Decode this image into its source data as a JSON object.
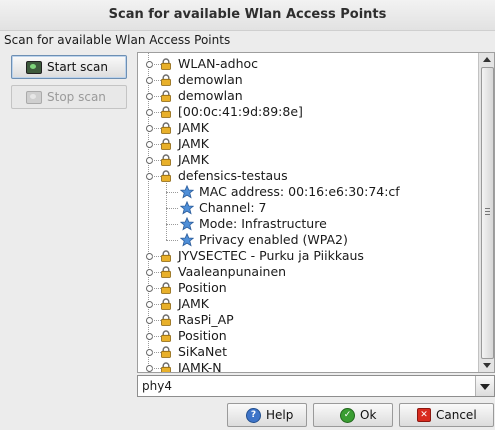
{
  "window": {
    "title": "Scan for available Wlan Access Points"
  },
  "subtitle": "Scan for available Wlan Access Points",
  "buttons": {
    "start_scan": "Start scan",
    "stop_scan": "Stop scan",
    "help": "Help",
    "ok": "Ok",
    "cancel": "Cancel"
  },
  "tree": {
    "items": [
      {
        "label": "WLAN-adhoc"
      },
      {
        "label": "demowlan"
      },
      {
        "label": "demowlan"
      },
      {
        "label": "[00:0c:41:9d:89:8e]"
      },
      {
        "label": "JAMK"
      },
      {
        "label": "JAMK"
      },
      {
        "label": "JAMK"
      },
      {
        "label": "defensics-testaus",
        "expanded": true,
        "children": [
          {
            "label": "MAC address: 00:16:e6:30:74:cf"
          },
          {
            "label": "Channel: 7"
          },
          {
            "label": "Mode: Infrastructure"
          },
          {
            "label": "Privacy enabled (WPA2)"
          }
        ]
      },
      {
        "label": "JYVSECTEC - Purku ja Piikkaus"
      },
      {
        "label": "Vaaleanpunainen"
      },
      {
        "label": "Position"
      },
      {
        "label": "JAMK"
      },
      {
        "label": "RasPi_AP"
      },
      {
        "label": "Position"
      },
      {
        "label": "SiKaNet"
      },
      {
        "label": "JAMK-N"
      }
    ]
  },
  "interface_select": {
    "value": "phy4"
  },
  "colors": {
    "lock": "#e8b02a",
    "star": "#4f8fd8",
    "ok": "#3a9d32",
    "cancel": "#d82b1f",
    "help": "#3e74c8"
  },
  "icons": {
    "network": "lock-icon",
    "property": "star-icon"
  }
}
